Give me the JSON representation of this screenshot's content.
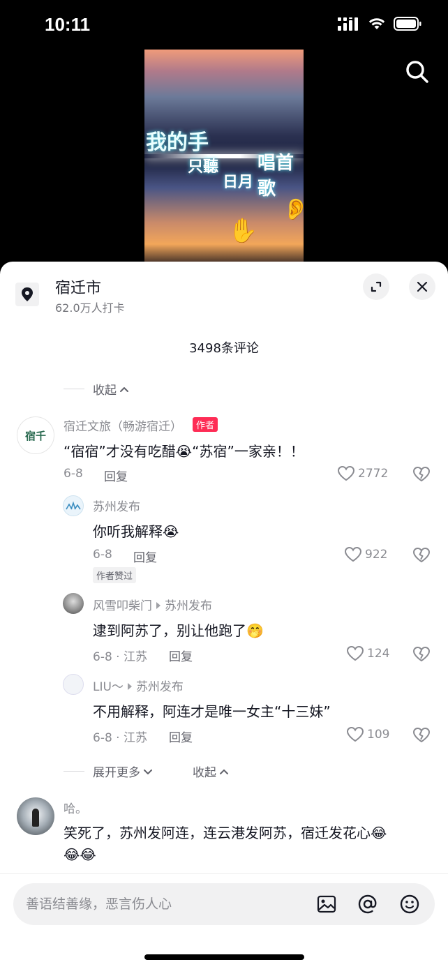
{
  "status": {
    "time": "10:11"
  },
  "video": {
    "line1": "我的手",
    "line2": "只聽",
    "line3": "日月",
    "line4": "唱首歌",
    "emoji_hand": "✋",
    "emoji_ear": "👂"
  },
  "location": {
    "name": "宿迁市",
    "checkins": "62.0万人打卡"
  },
  "comments_header": {
    "count_label": "3498条评论"
  },
  "collapse_top": "收起",
  "comments": [
    {
      "user": "宿迁文旅（畅游宿迁）",
      "badge": "作者",
      "avatar_text": "宿千",
      "text": "“宿宿”才没有吃醋😭“苏宿”一家亲！！",
      "date": "6-8",
      "reply": "回复",
      "likes": "2772"
    },
    {
      "user": "苏州发布",
      "text": "你听我解释😭",
      "date": "6-8",
      "reply": "回复",
      "likes": "922",
      "badge": "作者赞过"
    },
    {
      "user": "风雪叩柴门",
      "reply_to": "苏州发布",
      "text": "逮到阿苏了，别让他跑了🤭",
      "date": "6-8 · 江苏",
      "reply": "回复",
      "likes": "124"
    },
    {
      "user": "LIU～",
      "reply_to": "苏州发布",
      "text": "不用解释，阿连才是唯一女主“十三妹”",
      "date": "6-8 · 江苏",
      "reply": "回复",
      "likes": "109"
    },
    {
      "user": "哈。",
      "text_line1": "笑死了，苏州发阿连，连云港发阿苏，宿迁发花心😂",
      "text_line2": "😂😂"
    }
  ],
  "thread_controls": {
    "expand_more": "展开更多",
    "collapse": "收起"
  },
  "input": {
    "placeholder": "善语结善缘，恶言伤人心"
  },
  "icons": {
    "search": "search-icon",
    "location": "location-pin-icon",
    "expand": "expand-icon",
    "close": "close-icon",
    "like": "heart-icon",
    "dislike": "broken-heart-icon",
    "image": "image-icon",
    "mention": "at-icon",
    "emoji": "emoji-icon"
  },
  "colors": {
    "author_badge": "#fe2c55",
    "text_primary": "#161823",
    "text_secondary": "#8a8b91"
  }
}
